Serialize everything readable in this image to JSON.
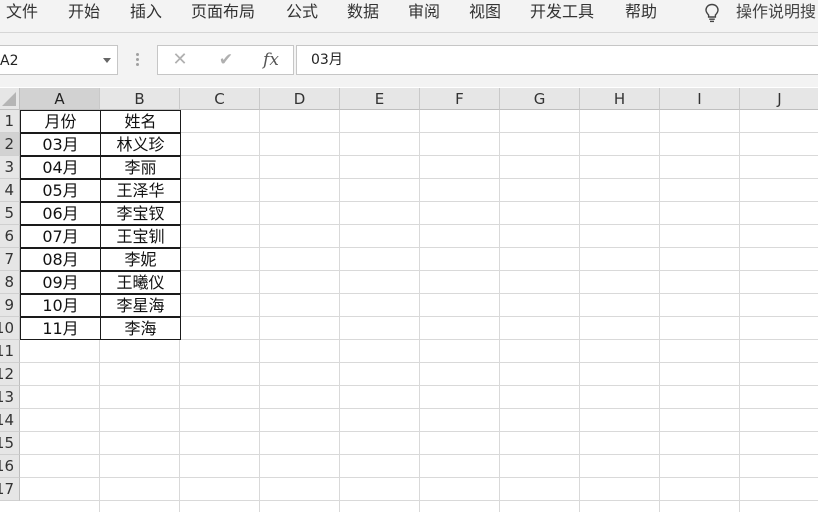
{
  "menu": {
    "items": [
      {
        "id": "file",
        "label": "文件"
      },
      {
        "id": "home",
        "label": "开始"
      },
      {
        "id": "insert",
        "label": "插入"
      },
      {
        "id": "page-layout",
        "label": "页面布局"
      },
      {
        "id": "formulas",
        "label": "公式"
      },
      {
        "id": "data",
        "label": "数据"
      },
      {
        "id": "review",
        "label": "审阅"
      },
      {
        "id": "view",
        "label": "视图"
      },
      {
        "id": "developer",
        "label": "开发工具"
      },
      {
        "id": "help",
        "label": "帮助"
      }
    ],
    "tell_me": "操作说明搜"
  },
  "formula_bar": {
    "name_box": "A2",
    "cancel_symbol": "✕",
    "enter_symbol": "✔",
    "fx_symbol": "fx",
    "content": "03月"
  },
  "sheet": {
    "columns": [
      "A",
      "B",
      "C",
      "D",
      "E",
      "F",
      "G",
      "H",
      "I",
      "J"
    ],
    "active_column": "A",
    "rows": [
      "1",
      "2",
      "3",
      "4",
      "5",
      "6",
      "7",
      "8",
      "9",
      "10",
      "11",
      "12",
      "13",
      "14",
      "15",
      "16",
      "17"
    ],
    "active_row": "2",
    "table": {
      "headers": [
        "月份",
        "姓名"
      ],
      "rows": [
        [
          "03月",
          "林义珍"
        ],
        [
          "04月",
          "李丽"
        ],
        [
          "05月",
          "王泽华"
        ],
        [
          "06月",
          "李宝钗"
        ],
        [
          "07月",
          "王宝钏"
        ],
        [
          "08月",
          "李妮"
        ],
        [
          "09月",
          "王曦仪"
        ],
        [
          "10月",
          "李星海"
        ],
        [
          "11月",
          "李海"
        ]
      ]
    }
  },
  "colors": {
    "ribbon_bg": "#f3f3f3",
    "header_bg": "#e6e6e6",
    "header_active_bg": "#d2d2d2",
    "gridline": "#d9d9d9",
    "table_border": "#1a1a1a"
  }
}
